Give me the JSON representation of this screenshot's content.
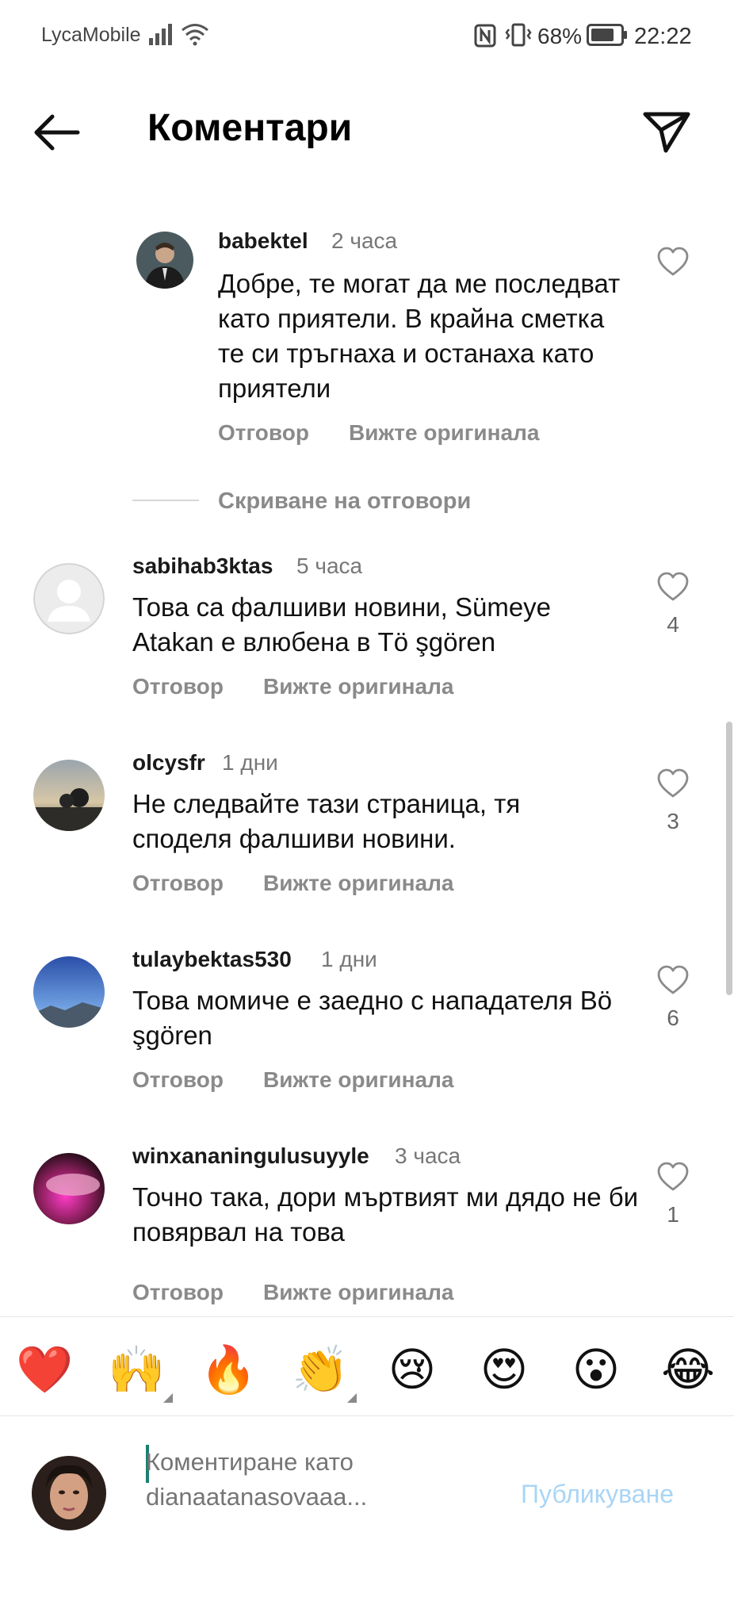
{
  "status_bar": {
    "carrier": "LycaMobile",
    "battery": "68%",
    "time": "22:22"
  },
  "header": {
    "title": "Коментари"
  },
  "comments": [
    {
      "user": "babektel",
      "time": "2 часа",
      "text": "Добре, те могат да ме последват като приятели. В крайна сметка те си тръгнаха и останаха като приятели",
      "reply_label": "Отговор",
      "original_label": "Вижте оригинала",
      "likes": ""
    },
    {
      "user": "sabihab3ktas",
      "time": "5 часа",
      "text": "Това са фалшиви новини, Sümeye Atakan е влюбена в Tö şgören",
      "reply_label": "Отговор",
      "original_label": "Вижте оригинала",
      "likes": "4"
    },
    {
      "user": "olcysfr",
      "time": "1 дни",
      "text": "Не следвайте тази страница, тя споделя фалшиви новини.",
      "reply_label": "Отговор",
      "original_label": "Вижте оригинала",
      "likes": "3"
    },
    {
      "user": "tulaybektas530",
      "time": "1 дни",
      "text": "Това момиче е заедно с нападателя Bö şgören",
      "reply_label": "Отговор",
      "original_label": "Вижте оригинала",
      "likes": "6"
    },
    {
      "user": "winxananingulusuyyle",
      "time": "3 часа",
      "text": "Точно така, дори мъртвият ми дядо не би повярвал на това",
      "reply_label": "Отговор",
      "original_label": "Вижте оригинала",
      "likes": "1"
    }
  ],
  "hide_replies_label": "Скриване на отговори",
  "reactions": [
    "❤️",
    "🙌",
    "🔥",
    "👏",
    "😢",
    "😍",
    "😮",
    "😂"
  ],
  "input": {
    "placeholder": "Коментиране като dianaatanasovaaa...",
    "post_label": "Публикуване"
  },
  "colors": {
    "post_button": "#a9d5f5",
    "heart_outline": "#8a8a8a",
    "secondary_text": "#8a8a8a"
  }
}
